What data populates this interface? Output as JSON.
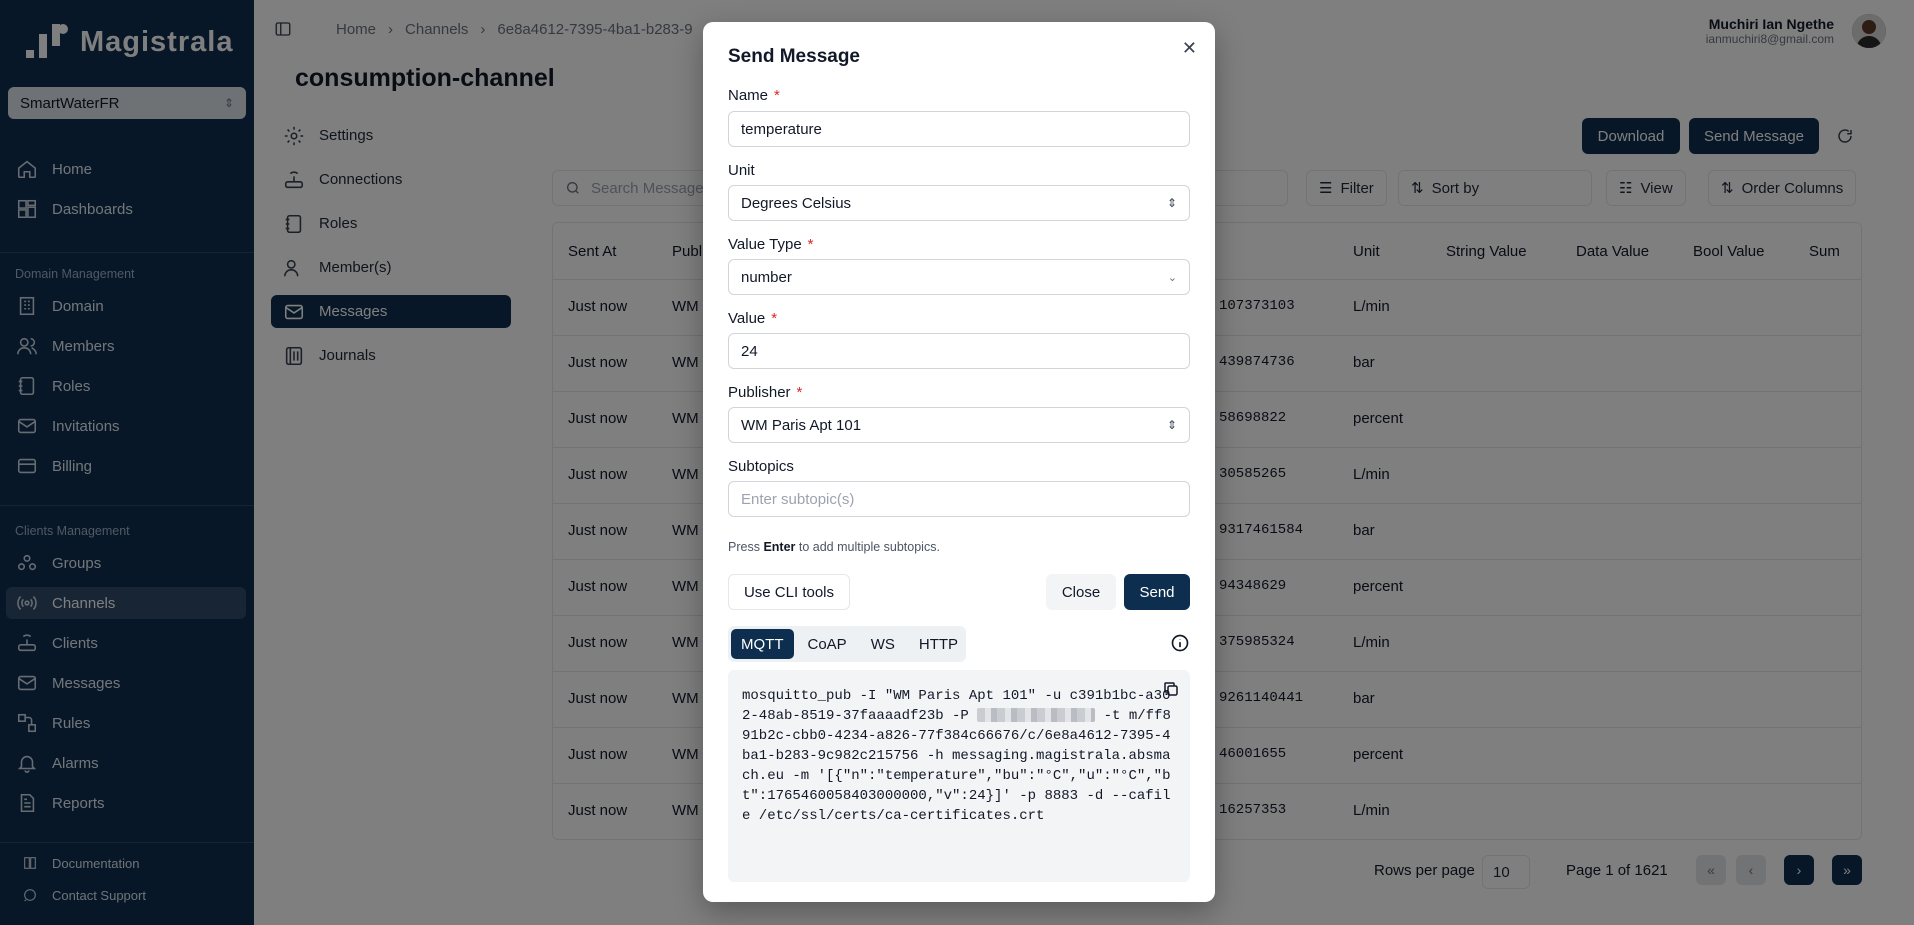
{
  "brand": {
    "name": "Magistrala"
  },
  "domain_select": {
    "value": "SmartWaterFR"
  },
  "sidebar": {
    "top_items": [
      {
        "label": "Home",
        "icon": "home-icon"
      },
      {
        "label": "Dashboards",
        "icon": "dashboard-icon"
      }
    ],
    "domain_section": "Domain Management",
    "domain_items": [
      {
        "label": "Domain",
        "icon": "building-icon"
      },
      {
        "label": "Members",
        "icon": "users-icon"
      },
      {
        "label": "Roles",
        "icon": "notebook-icon"
      },
      {
        "label": "Invitations",
        "icon": "mail-icon"
      },
      {
        "label": "Billing",
        "icon": "card-icon"
      }
    ],
    "clients_section": "Clients Management",
    "clients_items": [
      {
        "label": "Groups",
        "icon": "groups-icon"
      },
      {
        "label": "Channels",
        "icon": "broadcast-icon"
      },
      {
        "label": "Clients",
        "icon": "router-icon"
      },
      {
        "label": "Messages",
        "icon": "mail-icon"
      },
      {
        "label": "Rules",
        "icon": "flow-icon"
      },
      {
        "label": "Alarms",
        "icon": "bell-icon"
      },
      {
        "label": "Reports",
        "icon": "report-icon"
      }
    ],
    "footer": {
      "documentation": "Documentation",
      "support": "Contact Support"
    }
  },
  "breadcrumb": {
    "home": "Home",
    "channels": "Channels",
    "current": "6e8a4612-7395-4ba1-b283-9"
  },
  "user": {
    "name": "Muchiri Ian Ngethe",
    "email": "ianmuchiri8@gmail.com"
  },
  "page": {
    "title": "consumption-channel"
  },
  "subnav": [
    "Settings",
    "Connections",
    "Roles",
    "Member(s)",
    "Messages",
    "Journals"
  ],
  "toolbar": {
    "download": "Download",
    "send_message": "Send Message",
    "search_placeholder": "Search Message",
    "filter": "Filter",
    "sort_by": "Sort by",
    "view": "View",
    "order_columns": "Order Columns"
  },
  "table": {
    "headers": {
      "sent_at": "Sent At",
      "publisher": "Publi",
      "unit": "Unit",
      "string_value": "String Value",
      "data_value": "Data Value",
      "bool_value": "Bool Value",
      "sum": "Sum"
    },
    "rows": [
      {
        "sent_at": "Just now",
        "publisher": "WM",
        "value": "107373103",
        "unit": "L/min"
      },
      {
        "sent_at": "Just now",
        "publisher": "WM",
        "value": "439874736",
        "unit": "bar"
      },
      {
        "sent_at": "Just now",
        "publisher": "WM",
        "value": "58698822",
        "unit": "percent"
      },
      {
        "sent_at": "Just now",
        "publisher": "WM",
        "value": "30585265",
        "unit": "L/min"
      },
      {
        "sent_at": "Just now",
        "publisher": "WM",
        "value": "9317461584",
        "unit": "bar"
      },
      {
        "sent_at": "Just now",
        "publisher": "WM",
        "value": "94348629",
        "unit": "percent"
      },
      {
        "sent_at": "Just now",
        "publisher": "WM",
        "value": "375985324",
        "unit": "L/min"
      },
      {
        "sent_at": "Just now",
        "publisher": "WM",
        "value": "9261140441",
        "unit": "bar"
      },
      {
        "sent_at": "Just now",
        "publisher": "WM",
        "value": "46001655",
        "unit": "percent"
      },
      {
        "sent_at": "Just now",
        "publisher": "WM",
        "value": "16257353",
        "unit": "L/min"
      }
    ]
  },
  "pagination": {
    "rows_label": "Rows per page",
    "rows_value": "10",
    "page_label": "Page 1 of 1621"
  },
  "modal": {
    "title": "Send Message",
    "name_label": "Name",
    "name_value": "temperature",
    "unit_label": "Unit",
    "unit_value": "Degrees Celsius",
    "value_type_label": "Value Type",
    "value_type_value": "number",
    "value_label": "Value",
    "value_value": "24",
    "publisher_label": "Publisher",
    "publisher_value": "WM Paris Apt 101",
    "subtopics_label": "Subtopics",
    "subtopics_placeholder": "Enter subtopic(s)",
    "hint_prefix": "Press",
    "hint_key": "Enter",
    "hint_suffix": "to add multiple subtopics.",
    "cli_button": "Use CLI tools",
    "close_button": "Close",
    "send_button": "Send",
    "tabs": [
      "MQTT",
      "CoAP",
      "WS",
      "HTTP"
    ],
    "code_part1": "mosquitto_pub -I \"WM Paris Apt 101\" -u c391b1bc-a302-48ab-8519-37faaaadf23b -P ",
    "code_part2": " -t m/ff891b2c-cbb0-4234-a826-77f384c66676/c/6e8a4612-7395-4ba1-b283-9c982c215756 -h messaging.magistrala.absmach.eu -m '[{\"n\":\"temperature\",\"bu\":\"°C\",\"u\":\"°C\",\"bt\":1765460058403000000,\"v\":24}]' -p 8883 -d --cafile /etc/ssl/certs/ca-certificates.crt"
  }
}
